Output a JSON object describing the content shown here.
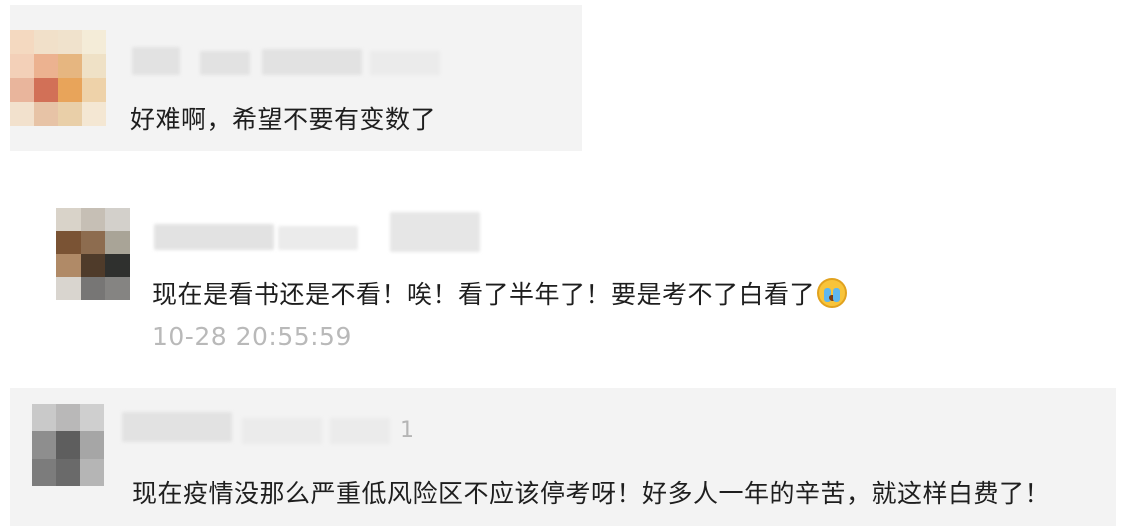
{
  "comments": [
    {
      "text": "好难啊，希望不要有变数了",
      "avatar_colors": [
        "#f4d9c0",
        "#f1e0c9",
        "#f0e2cc",
        "#f4ecd8",
        "#f3d0b8",
        "#ecb290",
        "#e6b680",
        "#efe1c6",
        "#e9b59c",
        "#d27057",
        "#e8a45a",
        "#eed2a9",
        "#f2e1cd",
        "#e7c3a6",
        "#e9cfa8",
        "#f4e7d3"
      ]
    },
    {
      "text": "现在是看书还是不看！唉！看了半年了！要是考不了白看了",
      "emoji": "crying-face-emoji",
      "timestamp": "10-28 20:55:59",
      "avatar_colors": [
        "#d9d3c9",
        "#c6bfb5",
        "#d3d0cb",
        "#7a5334",
        "#8d6c4f",
        "#a9a497",
        "#b08a67",
        "#4f3b2a",
        "#2f302e",
        "#d9d5cf",
        "#777675",
        "#858482"
      ]
    },
    {
      "text": "现在疫情没那么严重低风险区不应该停考呀！好多人一年的辛苦，就这样白费了！",
      "mark": "1",
      "avatar_colors": [
        "#c9c9c9",
        "#b9b8b8",
        "#cfcfcf",
        "#8e8e8e",
        "#5e5e5e",
        "#a6a6a6",
        "#7c7c7c",
        "#6a6a6a",
        "#b5b5b5"
      ]
    }
  ]
}
